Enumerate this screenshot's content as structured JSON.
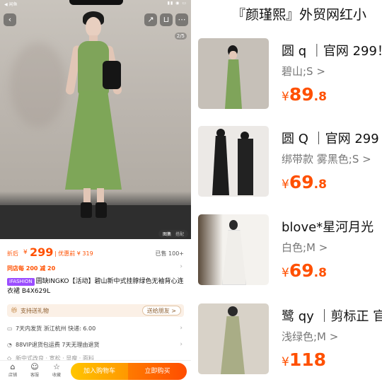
{
  "left": {
    "statusbar": {
      "back_app": "◀ 闲鱼"
    },
    "gallery": {
      "counter": "2/5",
      "tabs": [
        "图集",
        "搭配"
      ]
    },
    "price": {
      "label": "折后",
      "yen": "¥",
      "value": "299",
      "coupon": "| 优惠前 ¥ 319",
      "sold": "已售 100+"
    },
    "promo": "同店每 200 减 20",
    "title": {
      "tag": "iFASHION",
      "text": "圆缺INGKO【活动】碧山新中式挂脖绿色无袖背心连衣裙 B4X629L"
    },
    "gift": {
      "text": "支持送礼物",
      "button": "送给朋友 >"
    },
    "shipping": {
      "text": "7天内发货  浙江杭州  快递: 6.00"
    },
    "vip": {
      "text": "88VIP退货包运费   7天无理由退货"
    },
    "more": {
      "text": "新中式改良  ·  宽松  ·  显瘦  ·  面料"
    },
    "bottom": {
      "shop": "店铺",
      "service": "客服",
      "favorite": "收藏",
      "add_cart": "加入购物车",
      "buy_now": "立即购买"
    },
    "colors": {
      "accent": "#ff5000",
      "dress_green": "#7fa45a",
      "cart_button": "#ffa800",
      "buy_button": "#ff5a00"
    }
  },
  "right": {
    "title": "『颜瑾熙』外贸网红小",
    "items": [
      {
        "name": "圆 q ｜官网 299！",
        "variant": "碧山;S >",
        "yen": "¥",
        "price_int": "89",
        "price_dec": ".8"
      },
      {
        "name": "圆 Q ｜官网 299",
        "variant": "绑带款 雾黑色;S >",
        "yen": "¥",
        "price_int": "69",
        "price_dec": ".8"
      },
      {
        "name": "blove*星河月光",
        "variant": "白色;M >",
        "yen": "¥",
        "price_int": "69",
        "price_dec": ".8"
      },
      {
        "name": "鹭 qy ｜剪标正 官",
        "variant": "浅绿色;M >",
        "yen": "¥",
        "price_int": "118",
        "price_dec": ""
      }
    ]
  }
}
